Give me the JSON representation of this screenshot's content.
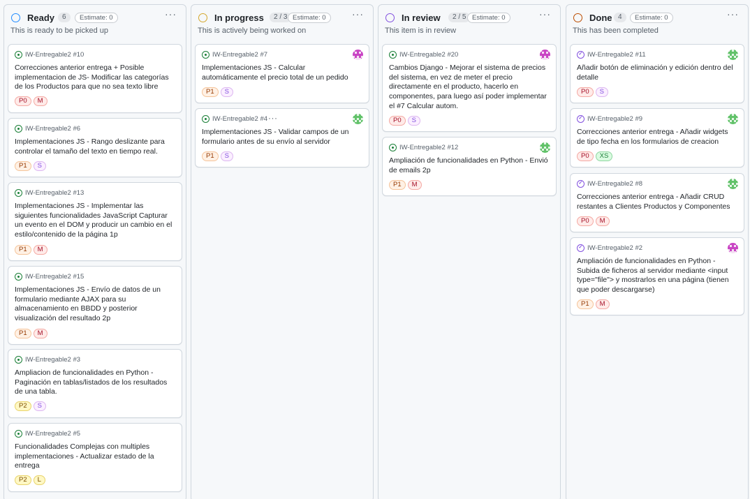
{
  "columns": [
    {
      "title": "Ready",
      "count": "6",
      "estimate": "Estimate: 0",
      "description": "This is ready to be picked up",
      "status_color": "#218bff",
      "cards": [
        {
          "ref": "IW-Entregable2 #10",
          "title": "Correcciones anterior entrega + Posible implementacion de JS- Modificar las categorías de los Productos para que no sea texto libre",
          "labels": [
            "P0",
            "M"
          ]
        },
        {
          "ref": "IW-Entregable2 #6",
          "title": "Implementaciones JS - Rango deslizante para controlar el tamaño del texto en tiempo real.",
          "labels": [
            "P1",
            "S"
          ]
        },
        {
          "ref": "IW-Entregable2 #13",
          "title": "Implementaciones JS - Implementar las siguientes funcionalidades JavaScript Capturar un evento en el DOM y producir un cambio en el estilo/contenido de la página 1p",
          "labels": [
            "P1",
            "M"
          ]
        },
        {
          "ref": "IW-Entregable2 #15",
          "title": "Implementaciones JS - Envío de datos de un formulario mediante AJAX para su almacenamiento en BBDD y posterior visualización del resultado 2p",
          "labels": [
            "P1",
            "M"
          ]
        },
        {
          "ref": "IW-Entregable2 #3",
          "title": "Ampliacion de funcionalidades en Python - Paginación en tablas/listados de los resultados de una tabla.",
          "labels": [
            "P2",
            "S"
          ]
        },
        {
          "ref": "IW-Entregable2 #5",
          "title": "Funcionalidades Complejas con multiples implementaciones - Actualizar estado de la entrega",
          "labels": [
            "P2",
            "L"
          ]
        }
      ]
    },
    {
      "title": "In progress",
      "count": "2 / 3",
      "estimate": "Estimate: 0",
      "description": "This is actively being worked on",
      "status_color": "#d4a72c",
      "cards": [
        {
          "ref": "IW-Entregable2 #7",
          "title": "Implementaciones JS - Calcular automáticamente el precio total de un pedido",
          "labels": [
            "P1",
            "S"
          ],
          "avatar": "pink"
        },
        {
          "ref": "IW-Entregable2 #4",
          "title": "Implementaciones JS - Validar campos de un formulario antes de su envío al servidor",
          "labels": [
            "P1",
            "S"
          ],
          "avatar": "green",
          "dots": "···"
        }
      ]
    },
    {
      "title": "In review",
      "count": "2 / 5",
      "estimate": "Estimate: 0",
      "description": "This item is in review",
      "status_color": "#8250df",
      "cards": [
        {
          "ref": "IW-Entregable2 #20",
          "title": "Cambios Django - Mejorar el sistema de precios del sistema, en vez de meter el precio directamente en el producto, hacerlo en componentes, para luego así poder implementar el #7 Calcular autom.",
          "labels": [
            "P0",
            "S"
          ],
          "avatar": "pink"
        },
        {
          "ref": "IW-Entregable2 #12",
          "title": "Ampliación de funcionalidades en Python - Envió de emails 2p",
          "labels": [
            "P1",
            "M"
          ],
          "avatar": "green"
        }
      ]
    },
    {
      "title": "Done",
      "count": "4",
      "estimate": "Estimate: 0",
      "description": "This has been completed",
      "status_color": "#bc4c00",
      "cards": [
        {
          "ref": "IW-Entregable2 #11",
          "title": "Añadir botón de eliminación y edición dentro del detalle",
          "labels": [
            "P0",
            "S"
          ],
          "avatar": "green",
          "done": true
        },
        {
          "ref": "IW-Entregable2 #9",
          "title": "Correcciones anterior entrega - Añadir widgets de tipo fecha en los formularios de creacion",
          "labels": [
            "P0",
            "XS"
          ],
          "avatar": "green",
          "done": true
        },
        {
          "ref": "IW-Entregable2 #8",
          "title": "Correcciones anterior entrega - Añadir CRUD restantes a Clientes Productos y Componentes",
          "labels": [
            "P0",
            "M"
          ],
          "avatar": "green",
          "done": true
        },
        {
          "ref": "IW-Entregable2 #2",
          "title": "Ampliación de funcionalidades en Python - Subida de ficheros al servidor mediante <input type=\"file\"> y mostrarlos en una página (tienen que poder descargarse)",
          "labels": [
            "P1",
            "M"
          ],
          "avatar": "pink",
          "done": true
        }
      ]
    }
  ],
  "more_icon": "···"
}
